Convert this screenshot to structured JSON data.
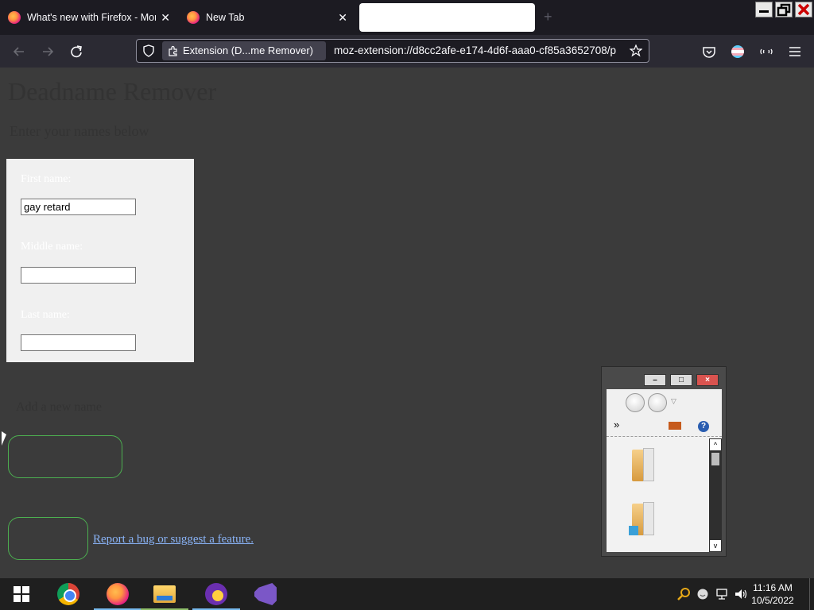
{
  "browser": {
    "tabs": [
      {
        "title": "What's new with Firefox - More",
        "close": "✕"
      },
      {
        "title": "New Tab",
        "close": "✕"
      },
      {
        "title": "",
        "close": ""
      }
    ],
    "new_tab_label": "+",
    "urlbar": {
      "extension_label": "Extension (D...me Remover)",
      "url": "moz-extension://d8cc2afe-e174-4d6f-aaa0-cf85a3652708/p"
    },
    "icons": [
      "back-icon",
      "forward-icon",
      "reload-icon",
      "shield-icon",
      "puzzle-icon",
      "star-icon",
      "pocket-icon",
      "account-icon",
      "extensions-icon",
      "menu-icon"
    ]
  },
  "page": {
    "heading": "Deadname Remover",
    "subheading": "Enter your names below",
    "form": {
      "first_name_label": "First name:",
      "first_name_value": "gay retard",
      "middle_name_label": "Middle name:",
      "middle_name_value": "",
      "last_name_label": "Last name:",
      "last_name_value": ""
    },
    "section_label": "Add a new name",
    "report_link": "Report a bug or suggest a feature.",
    "colors": {
      "button_border": "#4caf50",
      "link": "#8ab4f8",
      "page_bg": "#3b3b3b"
    }
  },
  "mini_window": {
    "minimize": "–",
    "maximize": "□",
    "close": "×",
    "chevron": "»",
    "help": "?",
    "scroll_up": "^",
    "scroll_down": "v"
  },
  "taskbar": {
    "apps": [
      "start-icon",
      "chrome-icon",
      "firefox-icon",
      "file-explorer-icon",
      "yahoo-messenger-icon",
      "visual-studio-icon"
    ],
    "tray_icons": [
      "search-tray-icon",
      "emoji-tray-icon",
      "network-icon",
      "volume-icon"
    ],
    "time": "11:16 AM",
    "date": "10/5/2022"
  }
}
